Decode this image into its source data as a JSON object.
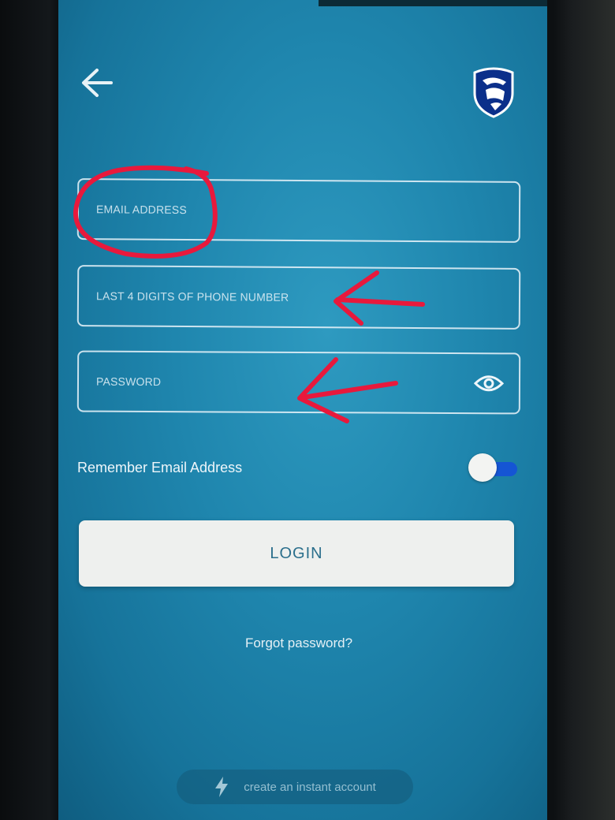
{
  "form": {
    "email_placeholder": "EMAIL ADDRESS",
    "phone_placeholder": "LAST 4 DIGITS OF PHONE NUMBER",
    "password_placeholder": "PASSWORD"
  },
  "remember": {
    "label": "Remember Email Address",
    "enabled": true
  },
  "actions": {
    "login_label": "LOGIN",
    "forgot_label": "Forgot password?",
    "instant_account_label": "create an instant account"
  },
  "icons": {
    "back": "arrow-left-icon",
    "logo": "shield-logo-icon",
    "eye": "eye-icon",
    "bolt": "lightning-bolt-icon"
  },
  "colors": {
    "screen_bg": "#1f86ae",
    "login_text": "#2b6f8c",
    "toggle_on": "#1555d4",
    "annotation_red": "#e8193c"
  }
}
